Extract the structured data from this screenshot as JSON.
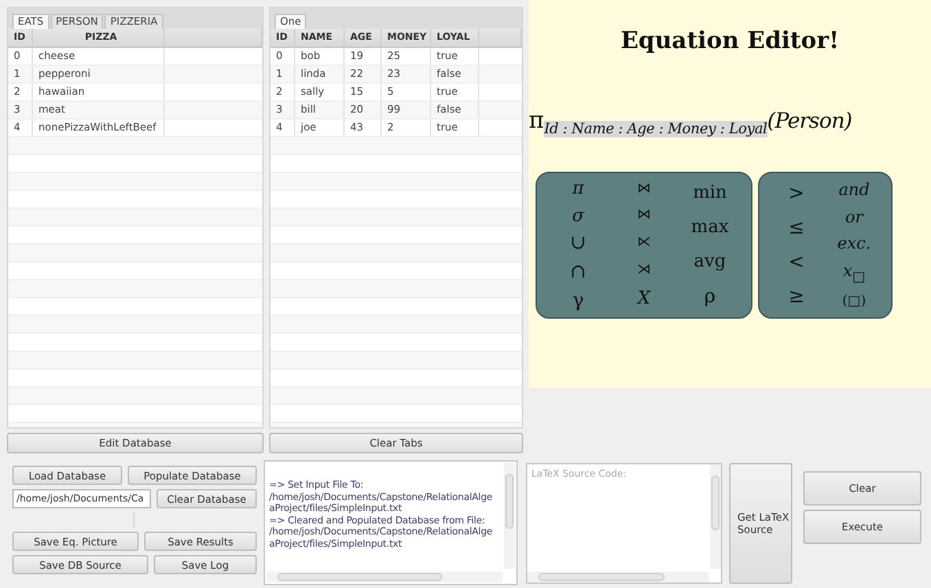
{
  "left_table": {
    "tabs": [
      {
        "label": "EATS",
        "selected": true
      },
      {
        "label": "PERSON",
        "selected": false
      },
      {
        "label": "PIZZERIA",
        "selected": false
      }
    ],
    "columns": [
      "ID",
      "PIZZA"
    ],
    "rows": [
      [
        "0",
        "cheese"
      ],
      [
        "1",
        "pepperoni"
      ],
      [
        "2",
        "hawaiian"
      ],
      [
        "3",
        "meat"
      ],
      [
        "4",
        "nonePizzaWithLeftBeef"
      ]
    ]
  },
  "left_button": "Edit Database",
  "right_table": {
    "tabs": [
      {
        "label": "One",
        "selected": true
      }
    ],
    "columns": [
      "ID",
      "NAME",
      "AGE",
      "MONEY",
      "LOYAL"
    ],
    "rows": [
      [
        "0",
        "bob",
        "19",
        "25",
        "true"
      ],
      [
        "1",
        "linda",
        "22",
        "23",
        "false"
      ],
      [
        "2",
        "sally",
        "15",
        "5",
        "true"
      ],
      [
        "3",
        "bill",
        "20",
        "99",
        "false"
      ],
      [
        "4",
        "joe",
        "43",
        "2",
        "true"
      ]
    ]
  },
  "right_button": "Clear Tabs",
  "equation_editor": {
    "title": "Equation Editor!",
    "expression": {
      "operator": "π",
      "subscript": "Id : Name : Age : Money : Loyal",
      "argument": "(Person)"
    },
    "palettes": [
      {
        "columns": [
          [
            {
              "symbol": "π",
              "kind": "greek"
            },
            {
              "symbol": "σ",
              "kind": "greek"
            },
            {
              "symbol": "∪",
              "kind": "operator"
            },
            {
              "symbol": "∩",
              "kind": "operator"
            },
            {
              "symbol": "γ",
              "kind": "operator"
            }
          ],
          [
            {
              "symbol": "⋈",
              "kind": "join"
            },
            {
              "symbol": "⋈",
              "kind": "join"
            },
            {
              "symbol": "⋉",
              "kind": "join"
            },
            {
              "symbol": "⋊",
              "kind": "join"
            },
            {
              "symbol": "X",
              "kind": "greek"
            }
          ],
          [
            {
              "symbol": "min",
              "kind": "function"
            },
            {
              "symbol": "max",
              "kind": "function"
            },
            {
              "symbol": "avg",
              "kind": "function"
            },
            {
              "symbol": "ρ",
              "kind": "operator"
            }
          ]
        ]
      },
      {
        "columns": [
          [
            {
              "symbol": ">",
              "kind": "operator"
            },
            {
              "symbol": "≤",
              "kind": "operator"
            },
            {
              "symbol": "<",
              "kind": "operator"
            },
            {
              "symbol": "≥",
              "kind": "operator"
            }
          ],
          [
            {
              "symbol": "and",
              "kind": "keyword"
            },
            {
              "symbol": "or",
              "kind": "keyword"
            },
            {
              "symbol": "exc.",
              "kind": "keyword"
            },
            {
              "symbol": "x$_{□}$",
              "kind": "keyword"
            },
            {
              "symbol": "(□)",
              "kind": "join"
            }
          ]
        ]
      }
    ]
  },
  "database_controls": {
    "load": "Load Database",
    "populate": "Populate Database",
    "path_field": {
      "value": "/home/josh/Documents/Ca"
    },
    "clear": "Clear Database",
    "save_picture": "Save Eq. Picture",
    "save_results": "Save Results",
    "save_source": "Save DB Source",
    "save_log": "Save Log"
  },
  "log": {
    "lines": [
      "=> Set Input File To:",
      "/home/josh/Documents/Capstone/RelationalAlge",
      "aProject/files/SimpleInput.txt",
      "=> Cleared and Populated Database from File:",
      "/home/josh/Documents/Capstone/RelationalAlge",
      "aProject/files/SimpleInput.txt"
    ]
  },
  "latex_field": {
    "placeholder": "LaTeX Source Code:"
  },
  "get_latex_button": "Get LaTeX Source",
  "actions": [
    "Clear",
    "Execute"
  ]
}
